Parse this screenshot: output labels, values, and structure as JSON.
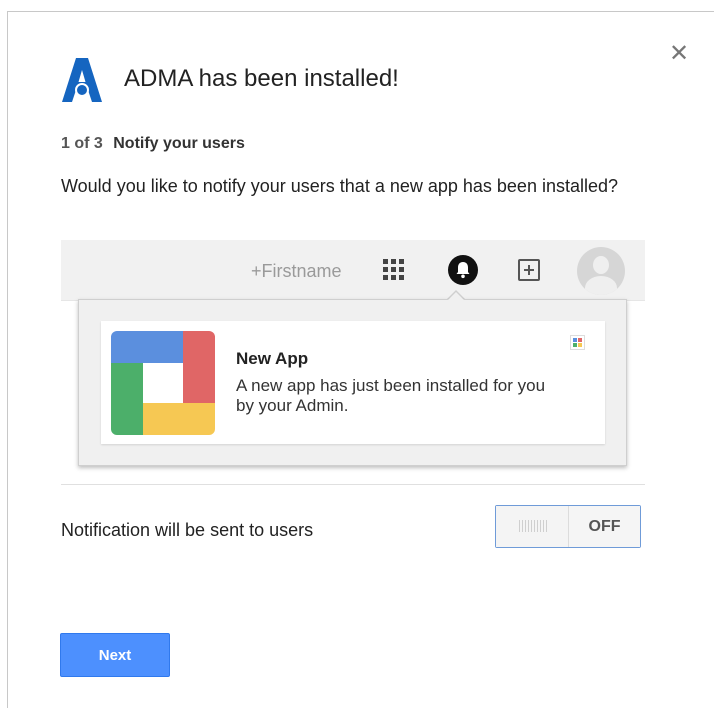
{
  "dialog": {
    "title": "ADMA has been installed!",
    "close_icon": "close-icon"
  },
  "step": {
    "count": "1 of 3",
    "label": "Notify your users"
  },
  "question": "Would you like to notify your users that a new app has been installed?",
  "preview": {
    "topbar": {
      "name": "+Firstname",
      "icons": [
        "apps-grid-icon",
        "notification-bell-icon",
        "add-box-icon",
        "avatar-icon"
      ]
    },
    "notification": {
      "title": "New App",
      "text": "A new app has just been installed for you by your Admin."
    }
  },
  "notification_toggle": {
    "label": "Notification will be sent to users",
    "state": "OFF"
  },
  "buttons": {
    "next": "Next"
  },
  "colors": {
    "primary_button": "#4d90fe",
    "logo_blue": "#1565c0",
    "toggle_border": "#6f9bd8"
  }
}
